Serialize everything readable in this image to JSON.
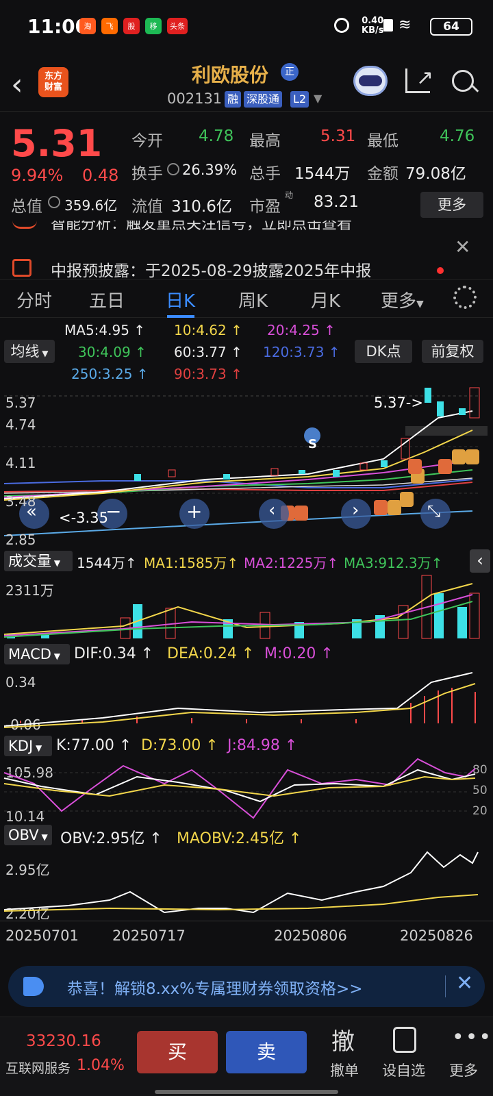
{
  "status": {
    "time": "11:00",
    "apps": [
      "淘",
      "飞",
      "股",
      "移",
      "头条"
    ],
    "speed_value": "0.40",
    "speed_unit": "KB/s",
    "battery": "64"
  },
  "header": {
    "logo_line1": "东方",
    "logo_line2": "财富",
    "stock_name": "利欧股份",
    "badge": "正",
    "code": "002131",
    "tags": [
      "融",
      "深股通",
      "L2"
    ]
  },
  "quote": {
    "price": "5.31",
    "pct": "9.94%",
    "change": "0.48",
    "open_label": "今开",
    "open": "4.78",
    "high_label": "最高",
    "high": "5.31",
    "low_label": "最低",
    "low": "4.76",
    "turnover_label": "换手",
    "turnover": "26.39%",
    "vol_label": "总手",
    "vol": "1544万",
    "amount_label": "金额",
    "amount": "79.08亿",
    "mcap_label": "总值",
    "mcap": "359.6亿",
    "float_label": "流值",
    "float": "310.6亿",
    "pe_label": "市盈",
    "pe_sup": "动",
    "pe": "83.21",
    "more": "更多"
  },
  "notices": {
    "line1": "智能分析：触发重点关注信号，立即点击查看",
    "line2": "中报预披露：于2025-08-29披露2025年中报"
  },
  "tabs": [
    "分时",
    "五日",
    "日K",
    "周K",
    "月K",
    "更多"
  ],
  "ma": {
    "selector": "均线",
    "ma5": "MA5:4.95",
    "ma10": "10:4.62",
    "ma20": "20:4.25",
    "ma30": "30:4.09",
    "ma60": "60:3.77",
    "ma120": "120:3.73",
    "ma250": "250:3.25",
    "ma90": "90:3.73",
    "dk": "DK点",
    "adjust": "前复权"
  },
  "kline": {
    "y_labels": [
      "5.37",
      "4.74",
      "4.11",
      "3.48",
      "2.85"
    ],
    "high_marker": "5.37->",
    "low_marker": "<-3.35",
    "signal_s": "S"
  },
  "volume": {
    "selector": "成交量",
    "value": "1544万",
    "ma1": "MA1:1585万",
    "ma2": "MA2:1225万",
    "ma3": "MA3:912.3万",
    "y_top": "2311万"
  },
  "macd": {
    "selector": "MACD",
    "dif": "DIF:0.34",
    "dea": "DEA:0.24",
    "m": "M:0.20",
    "y_top": "0.34",
    "y_bottom": "-0.06"
  },
  "kdj": {
    "selector": "KDJ",
    "k": "K:77.00",
    "d": "D:73.00",
    "j": "J:84.98",
    "y_top": "105.98",
    "y_bottom": "10.14",
    "r80": "80",
    "r50": "50",
    "r20": "20"
  },
  "obv": {
    "selector": "OBV",
    "obv": "OBV:2.95亿",
    "maobv": "MAOBV:2.45亿",
    "y_top": "2.95亿",
    "y_bottom": "2.20亿"
  },
  "dates": [
    "20250701",
    "20250717",
    "20250806",
    "20250826"
  ],
  "banner": {
    "text": "恭喜！解锁8.xx%专属理财券领取资格>>"
  },
  "bottom": {
    "index_value": "33230.16",
    "index_name": "互联网服务",
    "index_pct": "1.04%",
    "buy": "买",
    "sell": "卖",
    "cancel_glyph": "撤",
    "cancel_label": "撤单",
    "watch_label": "设自选",
    "more_label": "更多"
  }
}
